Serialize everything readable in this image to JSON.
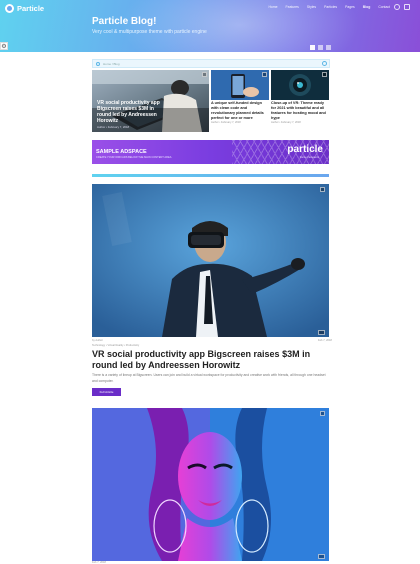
{
  "site": {
    "name": "Particle"
  },
  "nav": {
    "items": [
      "Home",
      "Features",
      "Styles",
      "Particles",
      "Pages",
      "Blog",
      "Contact"
    ],
    "active_index": 5
  },
  "hero": {
    "title": "Particle Blog!",
    "subtitle": "Very cool & multipurpose theme with particle engine"
  },
  "breadcrumb": {
    "text": "Home  /  Blog"
  },
  "featured": [
    {
      "title": "VR social productivity app Bigscreen raises $3M in round led by Andreessen Horowitz",
      "meta": "Author  •  February 7, 2018"
    },
    {
      "title": "A unique self-funded design with clean code and revolutionary planned details perfect for one or more",
      "meta": "Author  •  February 7, 2018"
    },
    {
      "title": "Close-up of VR: Theme ready for 2021 with beautiful and all features for hosting mood and hype",
      "meta": "Author  •  February 7, 2018"
    }
  ],
  "ad": {
    "title": "SAMPLE ADSPACE",
    "subtitle": "CREATE YOUR OWN ADS BELOW THE MAIN CONTENT AREA",
    "brand": "particle",
    "brand_sub": "theme framework"
  },
  "article": {
    "author": "by Author",
    "categories": "Technology  •  Virtual Reality  •  Productivity",
    "date": "Feb 7, 2018",
    "title": "VR social productivity app Bigscreen raises $3M in round led by Andreessen Horowitz",
    "excerpt": "There is a variety of lineup at Bigscreen. Users can join and build a virtual workspace for productivity and creative work with friends, all through one headset and computer.",
    "read_more": "Full Article"
  },
  "article2": {
    "date": "Feb 7, 2018"
  },
  "colors": {
    "accent": "#6a2dc8",
    "hero_start": "#5fd2ef",
    "hero_end": "#8a4fd8"
  }
}
